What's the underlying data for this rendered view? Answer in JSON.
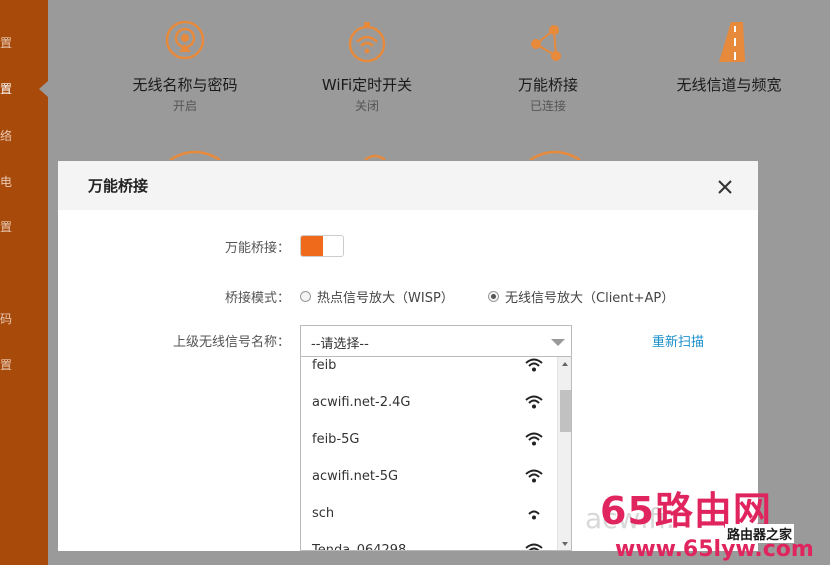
{
  "sidebar": {
    "items": [
      "置",
      "置",
      "络",
      "电",
      "置",
      "码",
      "置"
    ]
  },
  "tiles": [
    {
      "title": "无线名称与密码",
      "status": "开启",
      "icon": "wifi-signal-pin-icon"
    },
    {
      "title": "WiFi定时开关",
      "status": "关闭",
      "icon": "wifi-timer-icon"
    },
    {
      "title": "万能桥接",
      "status": "已连接",
      "icon": "bridge-nodes-icon"
    },
    {
      "title": "无线信道与频宽",
      "status": "",
      "icon": "road-channel-icon"
    }
  ],
  "dialog": {
    "title": "万能桥接",
    "close_icon": "close-icon",
    "bridge_label": "万能桥接：",
    "bridge_enabled": true,
    "mode_label": "桥接模式：",
    "mode_options": [
      {
        "label": "热点信号放大（WISP）",
        "checked": false
      },
      {
        "label": "无线信号放大（Client+AP）",
        "checked": true
      }
    ],
    "upstream_label": "上级无线信号名称：",
    "select_value": "--请选择--",
    "rescan_label": "重新扫描",
    "networks": [
      "feib",
      "acwifi.net-2.4G",
      "feib-5G",
      "acwifi.net-5G",
      "sch",
      "Tenda_064298"
    ]
  },
  "watermark": {
    "main": "65路由网",
    "sub": "路由器之家",
    "url": "www.65lyw.com",
    "ghost": "acwifi."
  },
  "colors": {
    "accent": "#f06a1c",
    "sidebar": "#a84a0a",
    "link": "#1a8fc9",
    "icon_orange": "#e88a3c"
  }
}
